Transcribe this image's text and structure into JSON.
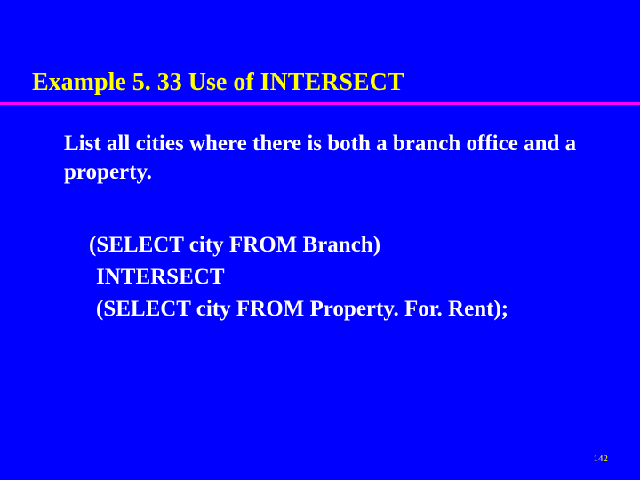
{
  "slide": {
    "title": "Example 5. 33  Use of INTERSECT",
    "description": "List all cities where there is both a branch office and a property.",
    "code": {
      "line1": "(SELECT city FROM Branch)",
      "line2": "INTERSECT",
      "line3": "(SELECT city FROM Property. For. Rent);"
    },
    "page_number": "142"
  }
}
